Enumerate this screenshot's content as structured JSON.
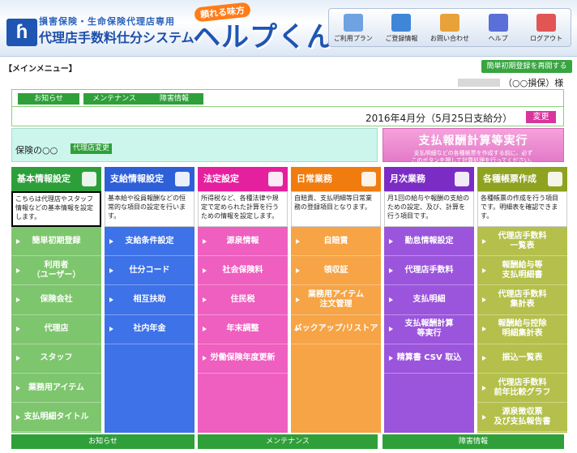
{
  "header": {
    "subtitle": "損害保険・生命保険代理店専用",
    "system_title": "代理店手数料仕分システム",
    "tagline": "頼れる味方",
    "product_name": "ヘルプくん",
    "nav": [
      {
        "label": "ご利用プラン",
        "icon": "plan-list-icon",
        "color": "#6fa2e0"
      },
      {
        "label": "ご登録情報",
        "icon": "registration-info-icon",
        "color": "#3f86d8"
      },
      {
        "label": "お問い合わせ",
        "icon": "mail-icon",
        "color": "#e8a23a"
      },
      {
        "label": "ヘルプ",
        "icon": "help-question-icon",
        "color": "#5b6fd8"
      },
      {
        "label": "ログアウト",
        "icon": "logout-close-icon",
        "color": "#e25555"
      }
    ]
  },
  "main_menu_label": "【メインメニュー】",
  "simple_setup_button": "簡単初期登録を再開する",
  "user": {
    "name_suffix": "（○○損保）様"
  },
  "tabs": [
    "お知らせ",
    "メンテナンス",
    "障害情報"
  ],
  "period_label": "2016年4月分（5月25日支給分）",
  "change_button": "変更",
  "company": {
    "name": "保険の○○",
    "change_button": "代理店変更"
  },
  "calc_button": {
    "title": "支払報酬計算等実行",
    "desc_line1": "支払明細などの各種帳票を作成する前に、必ず",
    "desc_line2": "このボタンを押して計算処理を行ってください。"
  },
  "columns": [
    {
      "title": "基本情報設定",
      "icon": "gear-icon",
      "head_color": "#2d9f3a",
      "item_color": "#7ec66e",
      "desc": "こちらは代理店やスタッフ情報などの基本情報を設定します。",
      "items": [
        "簡単初期登録",
        "利用者\n（ユーザー）",
        "保険会社",
        "代理店",
        "スタッフ",
        "業務用アイテム",
        "支払明細タイトル"
      ]
    },
    {
      "title": "支給情報設定",
      "icon": "cards-icon",
      "head_color": "#2e5fd6",
      "item_color": "#3d72e8",
      "desc": "基本給や役員報酬などの恒常的な項目の設定を行います。",
      "items": [
        "支給条件設定",
        "仕分コード",
        "相互扶助",
        "社内年金"
      ]
    },
    {
      "title": "法定設定",
      "icon": "document-icon",
      "head_color": "#e5209e",
      "item_color": "#ee5fbf",
      "desc": "所得税など、各種法律や規定で定められた計算を行うための情報を設定します。",
      "items": [
        "源泉情報",
        "社会保険料",
        "住民税",
        "年末調整",
        "労働保険年度更新"
      ]
    },
    {
      "title": "日常業務",
      "icon": "day-calendar-icon",
      "head_color": "#f07c10",
      "item_color": "#f6a445",
      "desc": "自賠責、支払明細等日常業務の登録項目となります。",
      "items": [
        "自賠責",
        "領収証",
        "業務用アイテム\n注文管理",
        "バックアップ/リストア"
      ]
    },
    {
      "title": "月次業務",
      "icon": "month-calendar-icon",
      "head_color": "#7b2cc4",
      "item_color": "#9b55dc",
      "desc": "月1回の給与や報酬の支給のための設定、及び、計算を行う項目です。",
      "items": [
        "勤怠情報設定",
        "代理店手数料",
        "支払明細",
        "支払報酬計算\n等実行",
        "精算書 CSV 取込"
      ]
    },
    {
      "title": "各種帳票作成",
      "icon": "report-doc-icon",
      "head_color": "#8fa321",
      "item_color": "#b4c04b",
      "desc": "各種帳票の作成を行う項目です。明細表を確認できます。",
      "items": [
        "代理店手数料\n一覧表",
        "報酬給与等\n支払明細書",
        "代理店手数料\n集計表",
        "報酬給与控除\n明細集計表",
        "振込一覧表",
        "代理店手数料\n前年比較グラフ",
        "源泉徴収票\n及び支払報告書"
      ]
    }
  ],
  "bottom_sections": [
    "お知らせ",
    "メンテナンス",
    "障害情報"
  ]
}
